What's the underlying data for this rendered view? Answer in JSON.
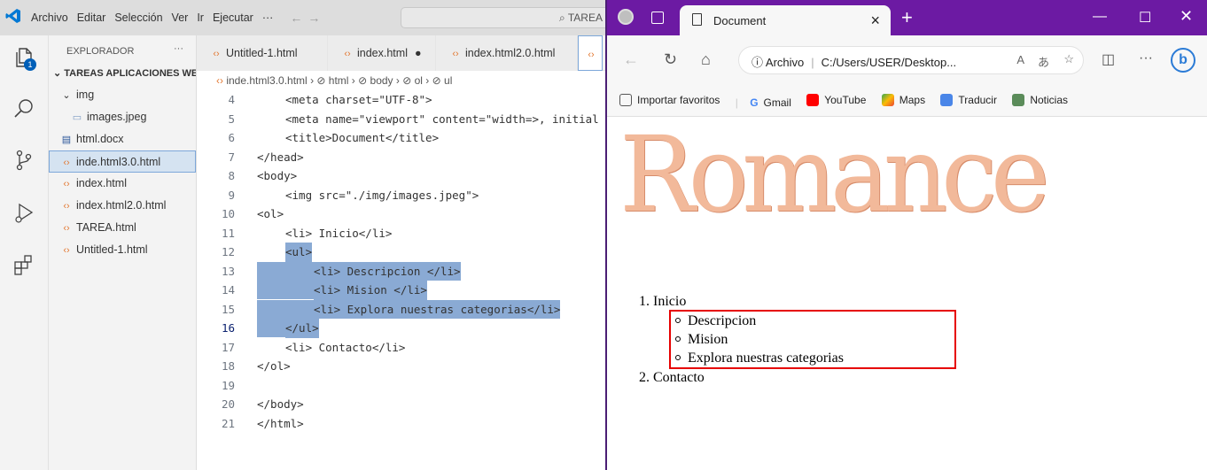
{
  "vscode": {
    "menu": [
      "Archivo",
      "Editar",
      "Selección",
      "Ver",
      "Ir",
      "Ejecutar",
      "···"
    ],
    "command_center": "TAREA",
    "explorer": {
      "title": "EXPLORADOR",
      "more": "···",
      "folder": "TAREAS APLICACIONES WEB",
      "items": [
        {
          "label": "img",
          "type": "folder"
        },
        {
          "label": "images.jpeg",
          "type": "image"
        },
        {
          "label": "html.docx",
          "type": "docx"
        },
        {
          "label": "inde.html3.0.html",
          "type": "html"
        },
        {
          "label": "index.html",
          "type": "html"
        },
        {
          "label": "index.html2.0.html",
          "type": "html"
        },
        {
          "label": "TAREA.html",
          "type": "html"
        },
        {
          "label": "Untitled-1.html",
          "type": "html"
        }
      ]
    },
    "source_control_badge": "1",
    "tabs": [
      "Untitled-1.html",
      "index.html",
      "index.html2.0.html"
    ],
    "breadcrumb": [
      "inde.html3.0.html",
      "html",
      "body",
      "ol",
      "ul"
    ],
    "lines": [
      {
        "n": "4",
        "text": "<meta charset=\"UTF-8\">"
      },
      {
        "n": "5",
        "text": "<meta name=\"viewport\" content=\"width=>, initial"
      },
      {
        "n": "6",
        "text": "<title>Document</title>"
      },
      {
        "n": "7",
        "text": "</head>"
      },
      {
        "n": "8",
        "text": "<body>"
      },
      {
        "n": "9",
        "text": "<img src=\"./img/images.jpeg\">"
      },
      {
        "n": "10",
        "text": "<ol>"
      },
      {
        "n": "11",
        "text": "<li> Inicio</li>"
      },
      {
        "n": "12",
        "text": "<ul>"
      },
      {
        "n": "13",
        "text": "<li> Descripcion </li>"
      },
      {
        "n": "14",
        "text": "<li> Mision </li>"
      },
      {
        "n": "15",
        "text": "<li> Explora nuestras categorias</li>"
      },
      {
        "n": "16",
        "text": "</ul>"
      },
      {
        "n": "17",
        "text": "<li> Contacto</li>"
      },
      {
        "n": "18",
        "text": "</ol>"
      },
      {
        "n": "19",
        "text": ""
      },
      {
        "n": "20",
        "text": "</body>"
      },
      {
        "n": "21",
        "text": "</html>"
      }
    ]
  },
  "browser": {
    "tab_title": "Document",
    "address_label": "Archivo",
    "address_url": "C:/Users/USER/Desktop...",
    "favorites": [
      "Importar favoritos",
      "Gmail",
      "YouTube",
      "Maps",
      "Traducir",
      "Noticias"
    ],
    "page": {
      "banner_text": "Romance",
      "list": [
        {
          "num": "1.",
          "text": "Inicio"
        },
        {
          "num": "2.",
          "text": "Contacto"
        }
      ],
      "sublist": [
        "Descripcion",
        "Mision",
        "Explora nuestras categorias"
      ]
    },
    "colors": {
      "titlebar": "#6c1aa3",
      "highlight_box": "#e60000",
      "selection": "#8aaad4"
    }
  }
}
